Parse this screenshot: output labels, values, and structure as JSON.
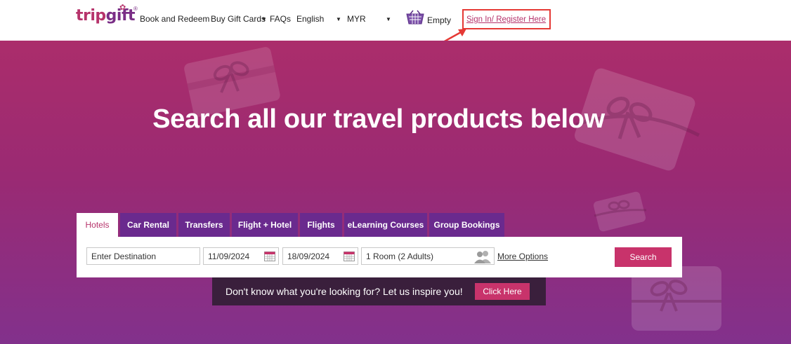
{
  "header": {
    "logo": {
      "trip": "trip",
      "gift": "gift"
    },
    "nav": {
      "book_redeem": "Book and Redeem",
      "buy_gift_cards": "Buy Gift Cards",
      "faqs": "FAQs",
      "language": "English",
      "currency": "MYR"
    },
    "cart": {
      "label": "Empty",
      "icon": "basket-icon"
    },
    "signin": "Sign In/ Register Here"
  },
  "hero": {
    "title": "Search all our travel products below"
  },
  "tabs": [
    {
      "label": "Hotels",
      "active": true
    },
    {
      "label": "Car Rental"
    },
    {
      "label": "Transfers"
    },
    {
      "label": "Flight + Hotel"
    },
    {
      "label": "Flights"
    },
    {
      "label": "eLearning Courses"
    },
    {
      "label": "Group Bookings"
    }
  ],
  "search": {
    "destination_placeholder": "Enter Destination",
    "checkin": "11/09/2024",
    "checkout": "18/09/2024",
    "rooms": "1 Room (2 Adults)",
    "more_options": "More Options",
    "button": "Search"
  },
  "inspire": {
    "text": "Don't know what you're looking for? Let us inspire you!",
    "button": "Click Here"
  },
  "colors": {
    "brand_pink": "#c8336b",
    "brand_purple": "#6a2a8e",
    "highlight_red": "#e53935",
    "hero_top": "#ab2d6b",
    "hero_bottom": "#82318c"
  }
}
